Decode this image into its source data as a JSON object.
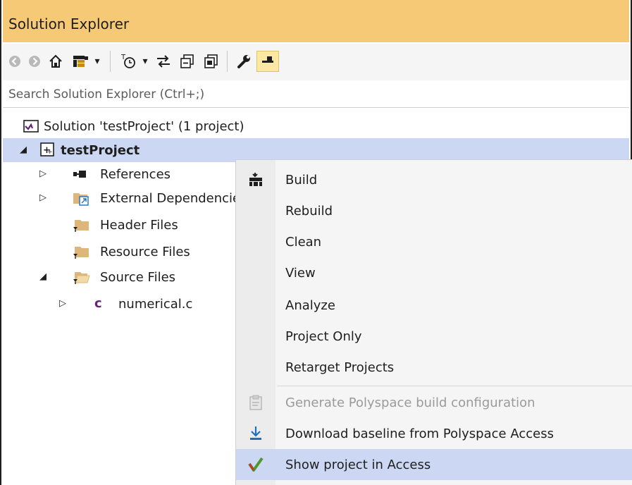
{
  "window": {
    "title": "Solution Explorer"
  },
  "toolbar": {
    "buttons": [
      {
        "icon": "back-icon",
        "glyph": "◀",
        "disabled": true
      },
      {
        "icon": "forward-icon",
        "glyph": "▶",
        "disabled": true
      },
      {
        "icon": "home-icon",
        "glyph": "⌂"
      },
      {
        "icon": "switch-views-icon",
        "glyph": "▦"
      },
      {
        "icon": "dropdown-arrow-icon",
        "glyph": "▾"
      },
      {
        "icon": "pending-changes-filter-icon",
        "glyph": "◷"
      },
      {
        "icon": "dropdown-arrow-icon",
        "glyph": "▾"
      },
      {
        "icon": "sync-active-document-icon",
        "glyph": "⇆"
      },
      {
        "icon": "collapse-all-icon",
        "glyph": "⊟"
      },
      {
        "icon": "show-all-files-icon",
        "glyph": "▤"
      },
      {
        "icon": "properties-wrench-icon",
        "glyph": "🔧"
      },
      {
        "icon": "preview-pin-icon",
        "glyph": "▬"
      }
    ]
  },
  "search": {
    "placeholder": "Search Solution Explorer (Ctrl+;)"
  },
  "tree": {
    "solution_label": "Solution 'testProject' (1 project)",
    "project_label": "testProject",
    "items": [
      {
        "label": "References"
      },
      {
        "label": "External Dependencies"
      },
      {
        "label": "Header Files"
      },
      {
        "label": "Resource Files"
      },
      {
        "label": "Source Files"
      },
      {
        "label": "numerical.c"
      }
    ]
  },
  "context_menu": {
    "items": [
      {
        "label": "Build"
      },
      {
        "label": "Rebuild"
      },
      {
        "label": "Clean"
      },
      {
        "label": "View"
      },
      {
        "label": "Analyze"
      },
      {
        "label": "Project Only"
      },
      {
        "label": "Retarget Projects"
      },
      {
        "label": "Generate Polyspace build configuration"
      },
      {
        "label": "Download baseline from Polyspace Access"
      },
      {
        "label": "Show project in Access"
      }
    ]
  },
  "colors": {
    "title_bar": "#f5c975",
    "selection": "#ccd8f3",
    "accent_c_file": "#68217a",
    "polyspace_check": "#4c9a2a"
  }
}
